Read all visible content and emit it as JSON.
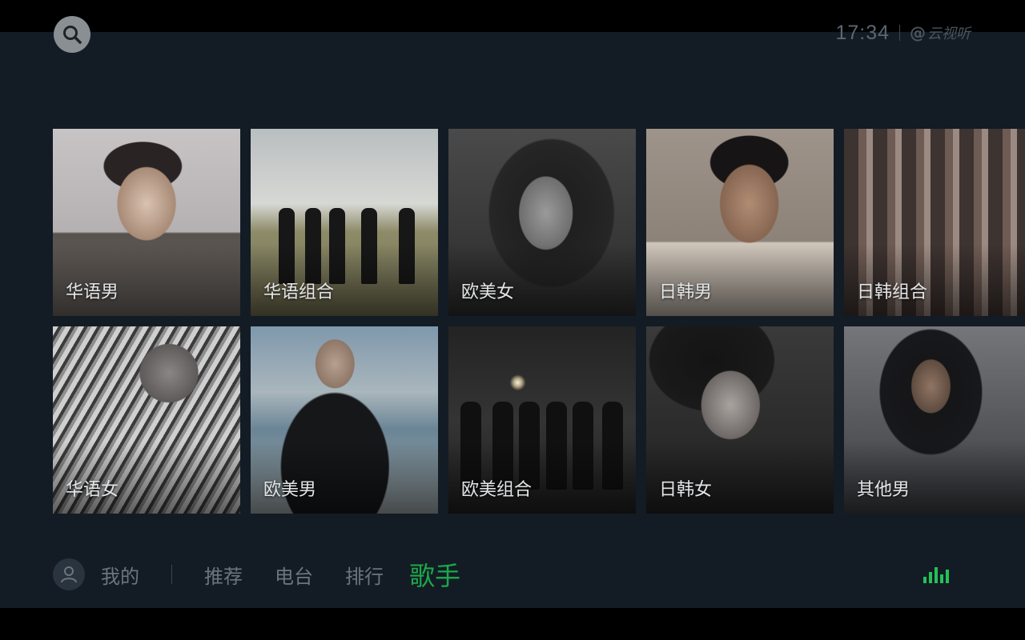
{
  "status": {
    "time": "17:34",
    "brand": "云视听"
  },
  "grid": {
    "tiles": [
      {
        "label": "华语男"
      },
      {
        "label": "华语组合"
      },
      {
        "label": "欧美女"
      },
      {
        "label": "日韩男"
      },
      {
        "label": "日韩组合"
      },
      {
        "label": "华语女"
      },
      {
        "label": "欧美男"
      },
      {
        "label": "欧美组合"
      },
      {
        "label": "日韩女"
      },
      {
        "label": "其他男"
      }
    ]
  },
  "nav": {
    "mine": "我的",
    "tabs": [
      "推荐",
      "电台",
      "排行"
    ],
    "active": "歌手"
  },
  "colors": {
    "accent": "#1ca84a",
    "background": "#131c25",
    "muted_text": "#6b757f"
  },
  "icons": {
    "search": "search-icon",
    "avatar": "user-icon",
    "playing": "equalizer-icon"
  }
}
